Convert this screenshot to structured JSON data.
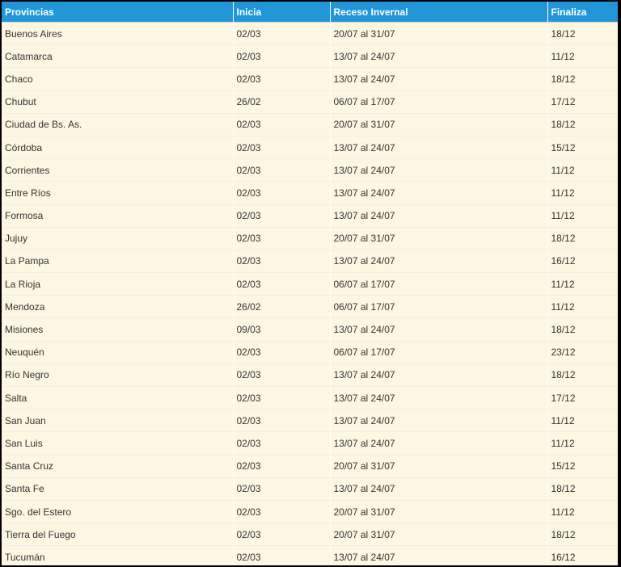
{
  "table": {
    "headers": [
      "Provincias",
      "Inicia",
      "Receso Invernal",
      "Finaliza"
    ],
    "rows": [
      [
        "Buenos Aires",
        "02/03",
        "20/07 al 31/07",
        "18/12"
      ],
      [
        "Catamarca",
        "02/03",
        "13/07 al 24/07",
        "11/12"
      ],
      [
        "Chaco",
        "02/03",
        "13/07 al 24/07",
        "18/12"
      ],
      [
        "Chubut",
        "26/02",
        "06/07 al 17/07",
        "17/12"
      ],
      [
        "Ciudad de Bs. As.",
        "02/03",
        "20/07 al 31/07",
        "18/12"
      ],
      [
        "Córdoba",
        "02/03",
        "13/07 al 24/07",
        "15/12"
      ],
      [
        "Corrientes",
        "02/03",
        "13/07 al 24/07",
        "11/12"
      ],
      [
        "Entre Ríos",
        "02/03",
        "13/07 al 24/07",
        "11/12"
      ],
      [
        "Formosa",
        "02/03",
        "13/07 al 24/07",
        "11/12"
      ],
      [
        "Jujuy",
        "02/03",
        "20/07 al 31/07",
        "18/12"
      ],
      [
        "La Pampa",
        "02/03",
        "13/07 al 24/07",
        "16/12"
      ],
      [
        "La Rioja",
        "02/03",
        "06/07 al 17/07",
        "11/12"
      ],
      [
        "Mendoza",
        "26/02",
        "06/07 al 17/07",
        "11/12"
      ],
      [
        "Misiones",
        "09/03",
        "13/07 al 24/07",
        "18/12"
      ],
      [
        "Neuquén",
        "02/03",
        "06/07 al 17/07",
        "23/12"
      ],
      [
        "Río Negro",
        "02/03",
        "13/07 al 24/07",
        "18/12"
      ],
      [
        "Salta",
        "02/03",
        "13/07 al 24/07",
        "17/12"
      ],
      [
        "San Juan",
        "02/03",
        "13/07 al 24/07",
        "11/12"
      ],
      [
        "San Luis",
        "02/03",
        "13/07 al 24/07",
        "11/12"
      ],
      [
        "Santa Cruz",
        "02/03",
        "20/07 al 31/07",
        "15/12"
      ],
      [
        "Santa Fe",
        "02/03",
        "13/07 al 24/07",
        "18/12"
      ],
      [
        "Sgo. del Estero",
        "02/03",
        "20/07 al 31/07",
        "11/12"
      ],
      [
        "Tierra del Fuego",
        "02/03",
        "20/07 al 31/07",
        "18/12"
      ],
      [
        "Tucumán",
        "02/03",
        "13/07 al 24/07",
        "16/12"
      ]
    ]
  },
  "colors": {
    "header_bg": "#2196d8",
    "header_text": "#ffffff",
    "row_bg": "#fdf6e3",
    "cell_text": "#333333",
    "outer_border": "#000000"
  }
}
